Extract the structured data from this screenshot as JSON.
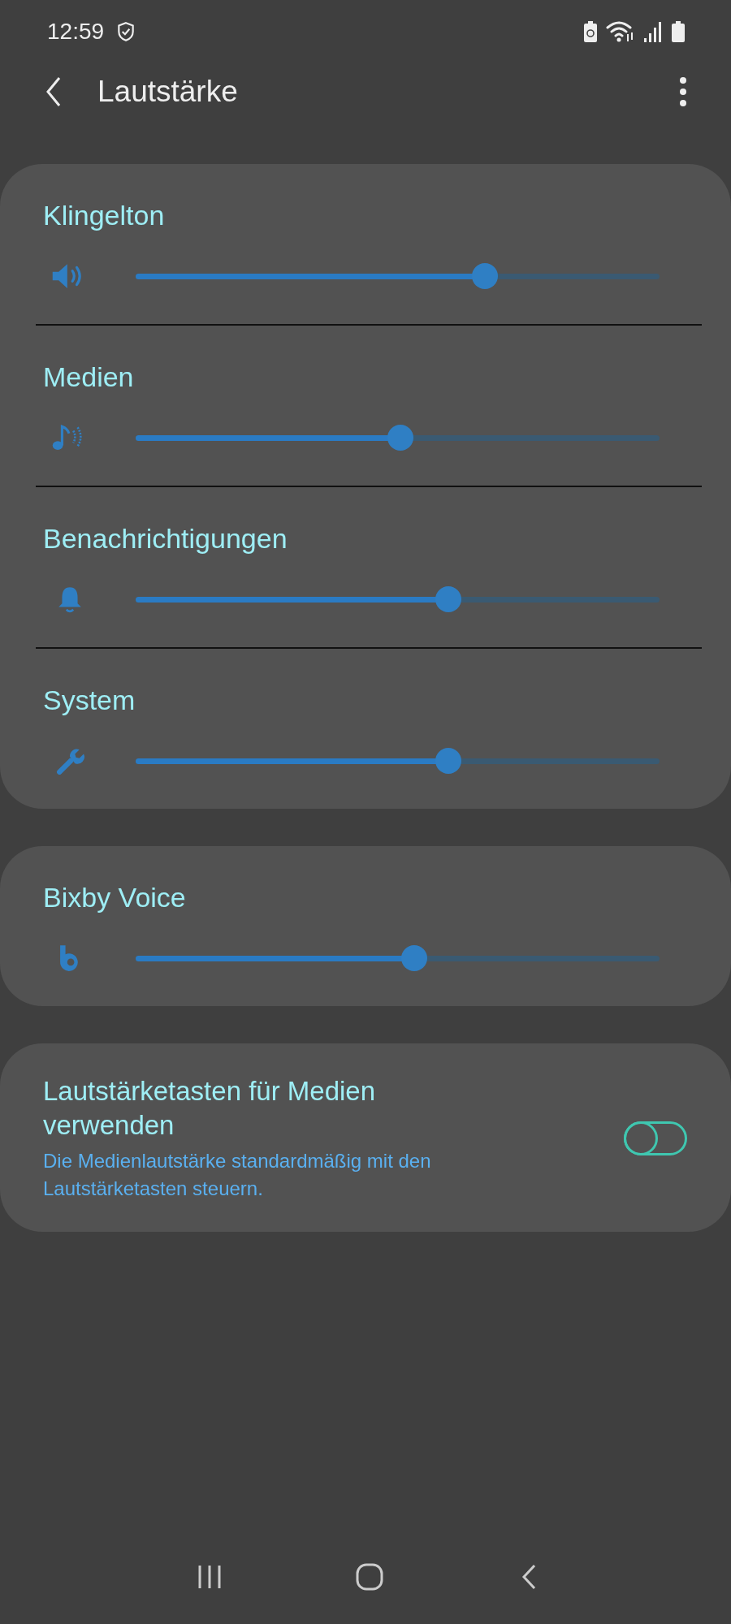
{
  "status_bar": {
    "time": "12:59"
  },
  "header": {
    "title": "Lautstärke"
  },
  "volume_sliders": [
    {
      "label": "Klingelton",
      "kind": "ring",
      "level": 0.667
    },
    {
      "label": "Medien",
      "kind": "media",
      "level": 0.506
    },
    {
      "label": "Benachrichtigungen",
      "kind": "notification",
      "level": 0.597
    },
    {
      "label": "System",
      "kind": "system",
      "level": 0.597
    }
  ],
  "bixby_slider": {
    "label": "Bixby Voice",
    "kind": "bixby",
    "level": 0.532
  },
  "media_keys": {
    "title": "Lautstärketasten für Medien verwenden",
    "description": "Die Medienlautstärke standardmäßig mit den Lautstärketasten steuern.",
    "on": false
  }
}
